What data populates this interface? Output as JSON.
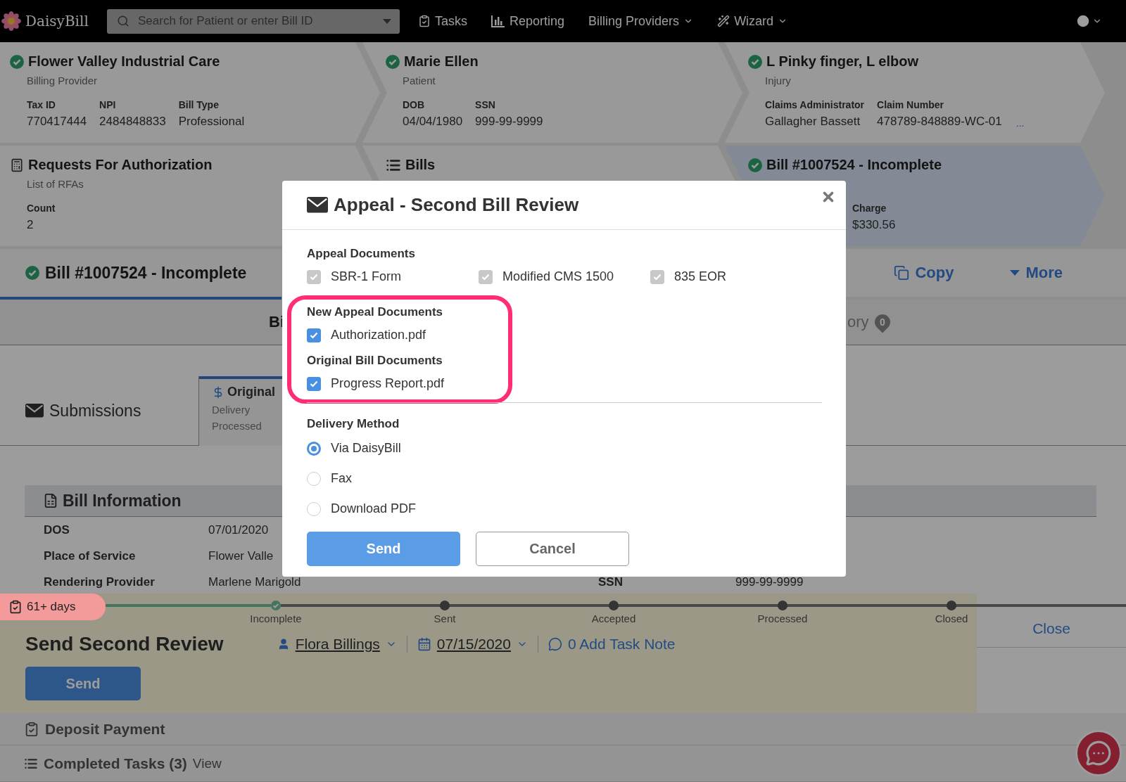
{
  "nav": {
    "logo": "DaisyBill",
    "search": {
      "placeholder": "Search for Patient or enter Bill ID"
    },
    "items": [
      {
        "label": "Tasks",
        "dropdown": false
      },
      {
        "label": "Reporting",
        "dropdown": false
      },
      {
        "label": "Billing Providers",
        "dropdown": true
      },
      {
        "label": "Wizard",
        "dropdown": true
      }
    ]
  },
  "summary": {
    "rows": [
      {
        "cards": [
          {
            "title": "Flower Valley Industrial Care",
            "subtitle": "Billing Provider",
            "kind": "status",
            "selected": false,
            "fields": [
              {
                "label": "Tax ID",
                "value": "770417444"
              },
              {
                "label": "NPI",
                "value": "2484848833"
              },
              {
                "label": "Bill Type",
                "value": "Professional"
              }
            ]
          },
          {
            "title": "Marie Ellen",
            "subtitle": "Patient",
            "kind": "status",
            "selected": false,
            "fields": [
              {
                "label": "DOB",
                "value": "04/04/1980"
              },
              {
                "label": "SSN",
                "value": "999-99-9999"
              }
            ]
          },
          {
            "title": "L Pinky finger, L elbow",
            "subtitle": "Injury",
            "kind": "status",
            "selected": false,
            "fields": [
              {
                "label": "Claims Administrator",
                "value": "Gallagher Bassett"
              },
              {
                "label": "Claim Number",
                "value": "478789-848889-WC-01"
              }
            ],
            "more": "..."
          }
        ]
      },
      {
        "cards": [
          {
            "title": "Requests For Authorization",
            "subtitle": "List of RFAs",
            "kind": "rfa",
            "selected": false,
            "fields": [
              {
                "label": "Count",
                "value": "2"
              }
            ]
          },
          {
            "title": "Bills",
            "kind": "list",
            "selected": false
          },
          {
            "title": "Bill #1007524 - Incomplete",
            "kind": "status",
            "selected": true,
            "fields": [
              {
                "label": "Charge",
                "value": "$330.56"
              }
            ]
          }
        ]
      }
    ]
  },
  "bill_header": {
    "title": "Bill #1007524 - Incomplete",
    "actions": [
      {
        "label": "Copy"
      },
      {
        "label": "More"
      }
    ]
  },
  "tabs": [
    {
      "label": "Bi",
      "selected": true
    },
    {
      "label": "ory",
      "badge": "0",
      "selected": false
    }
  ],
  "submissions": {
    "title": "Submissions",
    "tab": {
      "label": "Original",
      "lines": [
        "Delivery",
        "Processed"
      ],
      "selected": true
    }
  },
  "bill_info": {
    "title": "Bill Information",
    "rows": [
      {
        "label": "DOS",
        "value": "07/01/2020"
      },
      {
        "label": "Place of Service",
        "value": "Flower Valle"
      },
      {
        "label": "Rendering Provider",
        "value": "Marlene Marigold",
        "right": {
          "label": "SSN",
          "value": "999-99-9999"
        }
      }
    ]
  },
  "timeline": {
    "badge": "61+ days",
    "steps": [
      {
        "label": "Incomplete",
        "done": true
      },
      {
        "label": "Sent",
        "done": false
      },
      {
        "label": "Accepted",
        "done": false
      },
      {
        "label": "Processed",
        "done": false
      },
      {
        "label": "Closed",
        "done": false
      }
    ]
  },
  "task": {
    "title": "Send Second Review",
    "assignee": "Flora Billings",
    "date": "07/15/2020",
    "note": "0 Add Task Note",
    "button": "Send",
    "close": "Close"
  },
  "task_list": [
    {
      "label": "Deposit Payment"
    },
    {
      "label": "Completed Tasks (3)",
      "link": "View"
    }
  ],
  "modal": {
    "title": "Appeal - Second Bill Review",
    "sections": [
      {
        "heading": "Appeal Documents",
        "highlighted": false,
        "items": [
          {
            "label": "SBR-1 Form",
            "checked": true,
            "disabled": true
          },
          {
            "label": "Modified CMS 1500",
            "checked": true,
            "disabled": true
          },
          {
            "label": "835 EOR",
            "checked": true,
            "disabled": true
          }
        ]
      },
      {
        "heading": "New Appeal Documents",
        "highlighted": true,
        "items": [
          {
            "label": "Authorization.pdf",
            "checked": true,
            "disabled": false
          }
        ]
      },
      {
        "heading": "Original Bill Documents",
        "highlighted": true,
        "items": [
          {
            "label": "Progress Report.pdf",
            "checked": true,
            "disabled": false
          }
        ]
      }
    ],
    "delivery": {
      "heading": "Delivery Method",
      "options": [
        {
          "label": "Via DaisyBill",
          "selected": true
        },
        {
          "label": "Fax",
          "selected": false
        },
        {
          "label": "Download PDF",
          "selected": false
        }
      ]
    },
    "buttons": [
      {
        "label": "Send",
        "kind": "primary"
      },
      {
        "label": "Cancel",
        "kind": "secondary"
      }
    ]
  }
}
